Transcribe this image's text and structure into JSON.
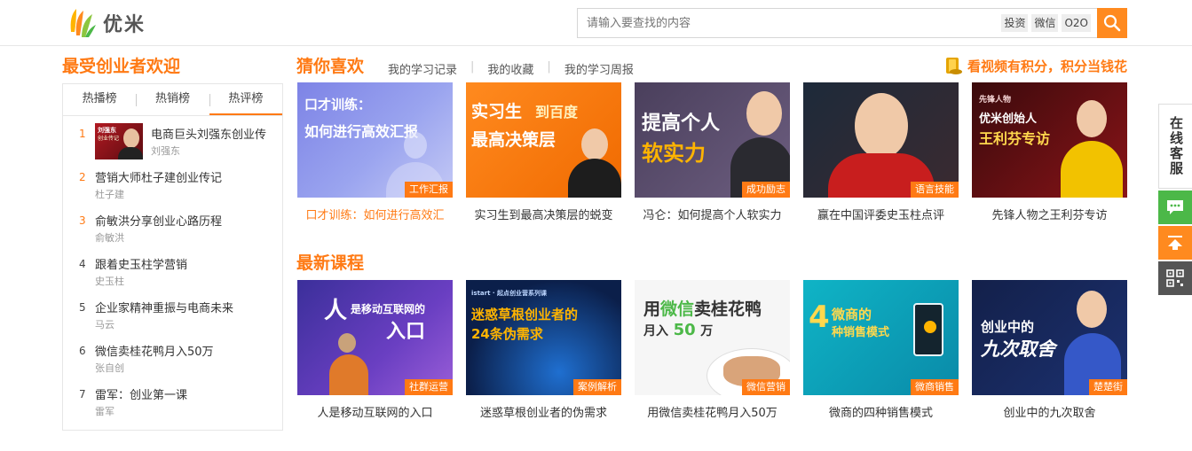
{
  "header": {
    "logo_text": "优米",
    "search_placeholder": "请输入要查找的内容",
    "search_tags": [
      "投资",
      "微信",
      "O2O"
    ]
  },
  "left": {
    "title": "最受创业者欢迎",
    "tabs": [
      "热播榜",
      "热销榜",
      "热评榜"
    ],
    "active_tab": 2,
    "thumb_text": [
      "刘强东",
      "创业传记"
    ],
    "ranking": [
      {
        "num": "1",
        "title": "电商巨头刘强东创业传",
        "author": "刘强东"
      },
      {
        "num": "2",
        "title": "营销大师杜子建创业传记",
        "author": "杜子建"
      },
      {
        "num": "3",
        "title": "俞敏洪分享创业心路历程",
        "author": "俞敏洪"
      },
      {
        "num": "4",
        "title": "跟着史玉柱学营销",
        "author": "史玉柱"
      },
      {
        "num": "5",
        "title": "企业家精神重振与电商未来",
        "author": "马云"
      },
      {
        "num": "6",
        "title": "微信卖桂花鸭月入50万",
        "author": "张自创"
      },
      {
        "num": "7",
        "title": "雷军：创业第一课",
        "author": "雷军"
      }
    ]
  },
  "guess": {
    "title": "猜你喜欢",
    "links": [
      "我的学习记录",
      "我的收藏",
      "我的学习周报"
    ],
    "promo": "看视频有积分，积分当钱花",
    "cards": [
      {
        "tag": "工作汇报",
        "caption": "口才训练：如何进行高效汇",
        "img_text": [
          "口才训练：",
          "如何进行高效汇报"
        ]
      },
      {
        "tag": "",
        "caption": "实习生到最高决策层的蜕变",
        "img_text": [
          "实习生",
          "到百度",
          "最高决策层"
        ]
      },
      {
        "tag": "成功励志",
        "caption": "冯仑：如何提高个人软实力",
        "img_text": [
          "提高个人",
          "软实力"
        ]
      },
      {
        "tag": "语言技能",
        "caption": "赢在中国评委史玉柱点评",
        "img_text": []
      },
      {
        "tag": "",
        "caption": "先锋人物之王利芬专访",
        "img_text": [
          "先锋人物",
          "优米创始人",
          "王利芬专访"
        ]
      }
    ]
  },
  "latest": {
    "title": "最新课程",
    "cards": [
      {
        "tag": "社群运营",
        "caption": "人是移动互联网的入口",
        "img_text": [
          "人",
          "是移动互联网的",
          "入口"
        ]
      },
      {
        "tag": "案例解析",
        "caption": "迷惑草根创业者的伪需求",
        "img_text": [
          "istart · 起点创业营系列课",
          "迷惑草根创业者的",
          "24条伪需求"
        ]
      },
      {
        "tag": "微信营销",
        "caption": "用微信卖桂花鸭月入50万",
        "img_text": [
          "用",
          "微信",
          "卖桂花鸭",
          "月入",
          "50",
          "万"
        ]
      },
      {
        "tag": "微商销售",
        "caption": "微商的四种销售模式",
        "img_text": [
          "4",
          "微商的",
          "种销售模式"
        ]
      },
      {
        "tag": "楚楚街",
        "caption": "创业中的九次取舍",
        "img_text": [
          "创业中的",
          "九次取舍"
        ]
      }
    ]
  },
  "float": {
    "kefu": "在线客服"
  },
  "colors": {
    "accent": "#ff7a14",
    "green": "#4cb848",
    "search_button": "#ff8a1f"
  }
}
